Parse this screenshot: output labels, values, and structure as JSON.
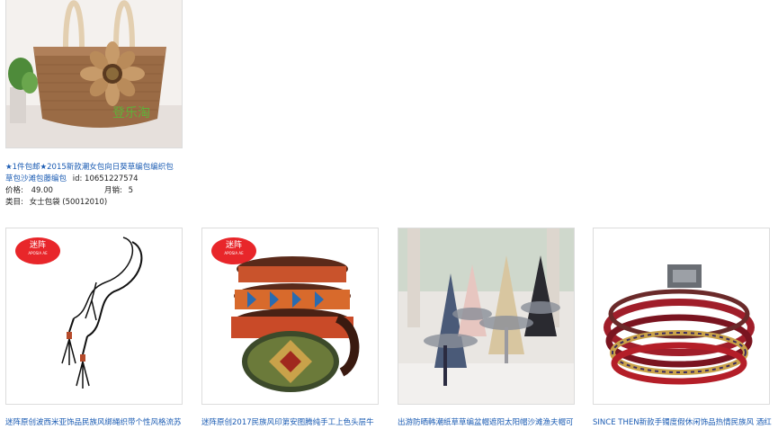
{
  "featured": {
    "title_line1": "★1件包邮★2015新款潮女包向日葵草编包编织包",
    "title_line2_prefix": "草包沙滩包藤编包",
    "id_label": "id: 10651227574",
    "price_label": "价格:",
    "price_value": "49.00",
    "sales_label": "月销:",
    "sales_value": "5",
    "category_label": "类目:",
    "category_value": "女士包袋 (50012010)",
    "image_watermark": "登乐淘"
  },
  "products": [
    {
      "title": "迷阵原创波西米亚饰品民族风绑绳织带个性风格流苏",
      "brand_badge": "迷阵",
      "brand_sub": "APOSIA AE"
    },
    {
      "title": "迷阵原创2017民族风印第安图腾纯手工上色头层牛",
      "brand_badge": "迷阵",
      "brand_sub": "APOSIA AE"
    },
    {
      "title": "出游防晒韩潮纸草草编盆帽遮阳太阳帽沙滩渔夫帽可"
    },
    {
      "title": "SINCE THEN新款手镯度假休闲饰品热情民族风 酒红"
    }
  ]
}
